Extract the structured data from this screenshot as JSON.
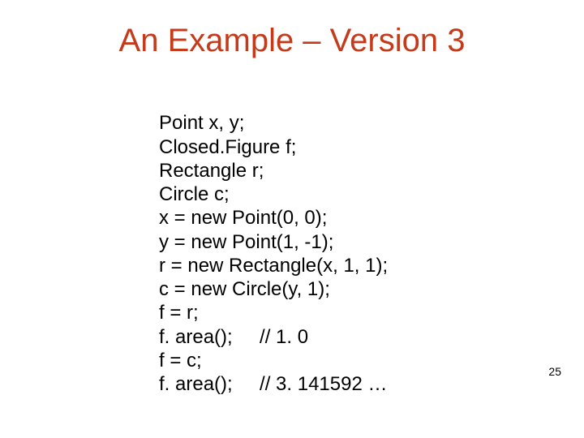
{
  "title": "An Example – Version 3",
  "code": {
    "l1": "Point x, y;",
    "l2": "Closed.Figure f;",
    "l3": "Rectangle r;",
    "l4": "Circle c;",
    "l5": "x = new Point(0, 0);",
    "l6": "y = new Point(1, -1);",
    "l7": "r = new Rectangle(x, 1, 1);",
    "l8": "c = new Circle(y, 1);",
    "l9": "f = r;",
    "l10": "f. area();     // 1. 0",
    "l11": "f = c;",
    "l12": "f. area();     // 3. 141592 …"
  },
  "page_number": "25"
}
